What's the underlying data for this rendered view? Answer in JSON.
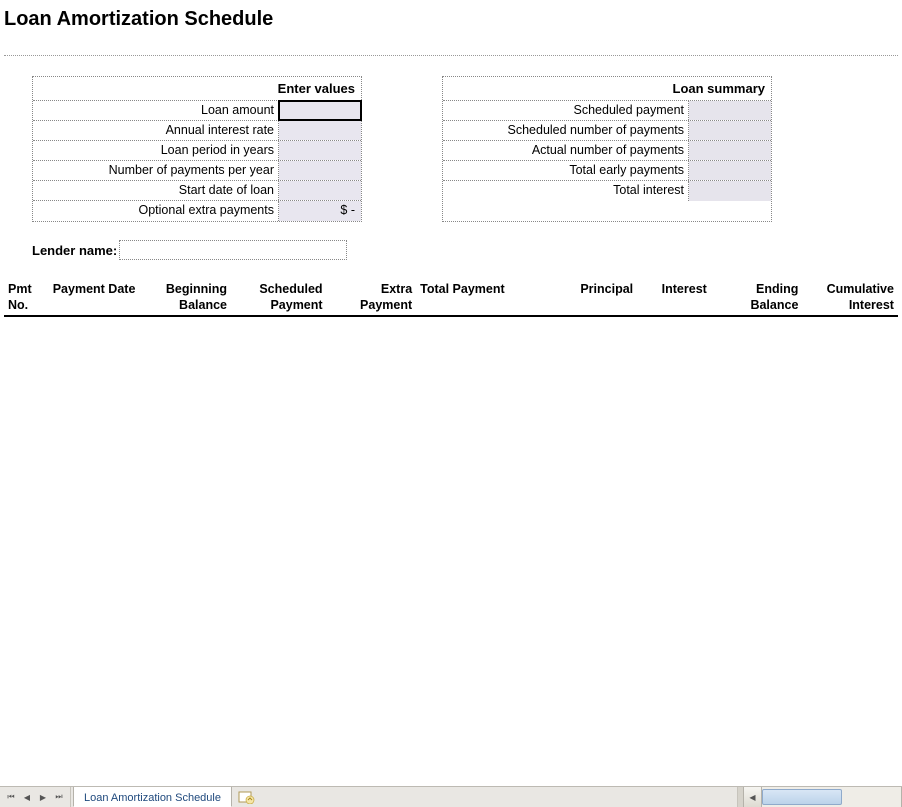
{
  "title": "Loan Amortization Schedule",
  "enter_values": {
    "header": "Enter values",
    "rows": [
      {
        "label": "Loan amount",
        "value": ""
      },
      {
        "label": "Annual interest rate",
        "value": ""
      },
      {
        "label": "Loan period in years",
        "value": ""
      },
      {
        "label": "Number of payments per year",
        "value": ""
      },
      {
        "label": "Start date of loan",
        "value": ""
      },
      {
        "label": "Optional extra payments",
        "value": "$          -"
      }
    ]
  },
  "loan_summary": {
    "header": "Loan summary",
    "rows": [
      {
        "label": "Scheduled payment",
        "value": ""
      },
      {
        "label": "Scheduled number of payments",
        "value": ""
      },
      {
        "label": "Actual number of payments",
        "value": ""
      },
      {
        "label": "Total early payments",
        "value": ""
      },
      {
        "label": "Total interest",
        "value": ""
      }
    ]
  },
  "lender": {
    "label": "Lender name:",
    "value": ""
  },
  "columns": {
    "pmtno": "Pmt No.",
    "date": "Payment Date",
    "begbal": "Beginning Balance",
    "sched": "Scheduled Payment",
    "extra": "Extra Payment",
    "totpay": "Total Payment",
    "princ": "Principal",
    "interest": "Interest",
    "endbal": "Ending Balance",
    "cumint": "Cumulative Interest"
  },
  "sheet_tab": "Loan Amortization Schedule"
}
